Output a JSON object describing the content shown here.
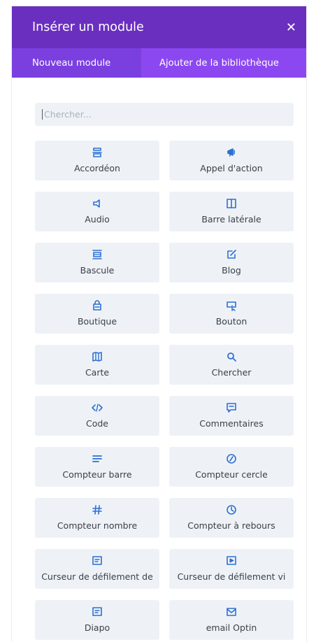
{
  "dialog": {
    "title": "Insérer un module",
    "close_icon": "close-icon"
  },
  "tabs": [
    {
      "label": "Nouveau module",
      "active": true
    },
    {
      "label": "Ajouter de la bibliothèque",
      "active": false
    }
  ],
  "search": {
    "placeholder": "Chercher...",
    "value": ""
  },
  "colors": {
    "header": "#6a2fbf",
    "tab_active": "#7b3fe0",
    "tab_inactive": "#8c48f0",
    "tile_bg": "#eef2f7",
    "icon": "#2d6fd2"
  },
  "modules": [
    {
      "label": "Accordéon",
      "icon": "accordion-icon"
    },
    {
      "label": "Appel d'action",
      "icon": "megaphone-icon"
    },
    {
      "label": "Audio",
      "icon": "audio-icon"
    },
    {
      "label": "Barre latérale",
      "icon": "sidebar-icon"
    },
    {
      "label": "Bascule",
      "icon": "toggle-icon"
    },
    {
      "label": "Blog",
      "icon": "blog-icon"
    },
    {
      "label": "Boutique",
      "icon": "shop-icon"
    },
    {
      "label": "Bouton",
      "icon": "button-icon"
    },
    {
      "label": "Carte",
      "icon": "map-icon"
    },
    {
      "label": "Chercher",
      "icon": "search-icon"
    },
    {
      "label": "Code",
      "icon": "code-icon"
    },
    {
      "label": "Commentaires",
      "icon": "comments-icon"
    },
    {
      "label": "Compteur barre",
      "icon": "bar-counter-icon"
    },
    {
      "label": "Compteur cercle",
      "icon": "circle-counter-icon"
    },
    {
      "label": "Compteur nombre",
      "icon": "hash-icon"
    },
    {
      "label": "Compteur à rebours",
      "icon": "countdown-icon"
    },
    {
      "label": "Curseur de défilement de",
      "icon": "post-slider-icon"
    },
    {
      "label": "Curseur de défilement vi",
      "icon": "video-slider-icon"
    },
    {
      "label": "Diapo",
      "icon": "slider-icon"
    },
    {
      "label": "email Optin",
      "icon": "email-icon"
    }
  ]
}
